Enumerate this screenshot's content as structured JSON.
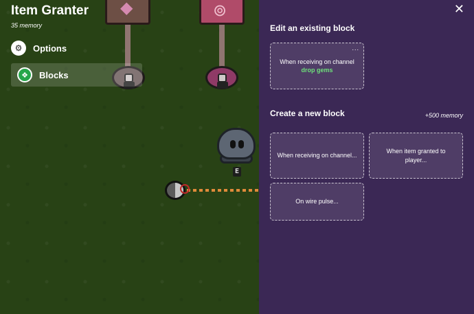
{
  "menu": {
    "title": "Item Granter",
    "memory": "35 memory",
    "items": [
      {
        "label": "Options",
        "icon": "gear-icon"
      },
      {
        "label": "Blocks",
        "icon": "blocks-icon"
      }
    ]
  },
  "world": {
    "key_hint": "E"
  },
  "panel": {
    "close_glyph": "✕",
    "edit_title": "Edit an existing block",
    "existing_block": {
      "text": "When receiving on channel",
      "channel": "drop gems",
      "menu_glyph": "..."
    },
    "create_title": "Create a new block",
    "create_cost": "+500 memory",
    "new_blocks": [
      "When receiving on channel...",
      "When item granted to player...",
      "On wire pulse..."
    ]
  },
  "colors": {
    "panel_bg": "#3b2855",
    "channel_green": "#6ee07a",
    "grass": "#2e4c19",
    "blocks_icon_green": "#27a64a"
  }
}
